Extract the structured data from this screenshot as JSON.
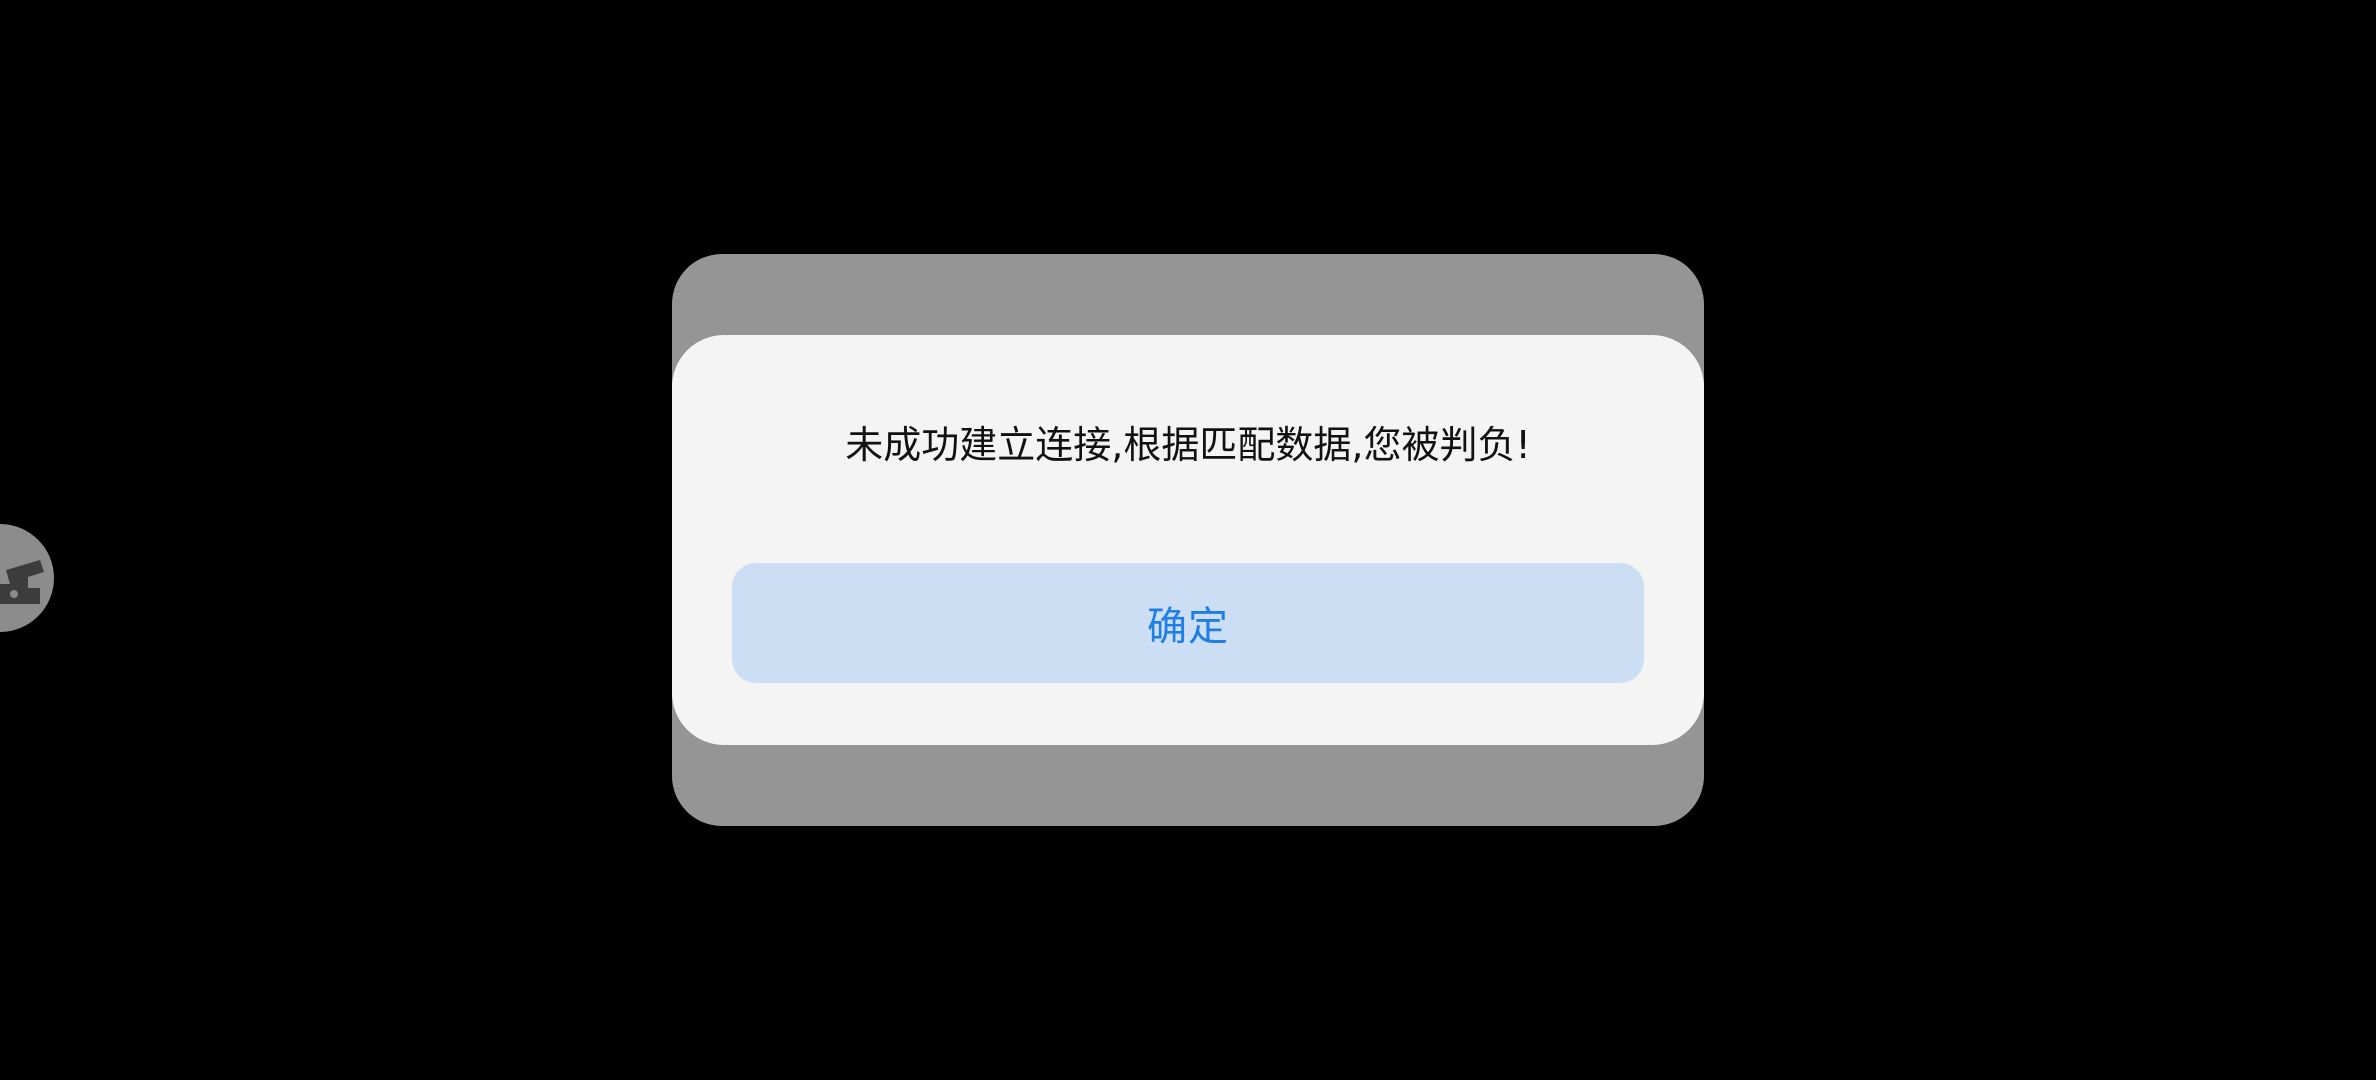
{
  "dialog": {
    "message": "未成功建立连接,根据匹配数据,您被判负!",
    "confirm_label": "确定"
  },
  "floating_widget": {
    "icon": "gamepad-icon"
  },
  "colors": {
    "background": "#000000",
    "back_panel": "#959595",
    "dialog": "#f4f4f4",
    "button_bg": "#ccdef4",
    "button_text": "#1f7fe7"
  }
}
